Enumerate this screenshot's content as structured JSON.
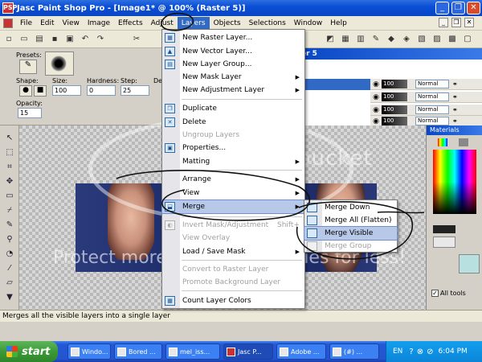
{
  "window": {
    "title": "Jasc Paint Shop Pro - [Image1* @ 100% (Raster 5)]",
    "app_icon": "PSP",
    "controls": [
      "_",
      "❐",
      "✕"
    ]
  },
  "menubar": {
    "items": [
      "File",
      "Edit",
      "View",
      "Image",
      "Effects",
      "Adjust",
      "Layers",
      "Objects",
      "Selections",
      "Window",
      "Help"
    ],
    "active": "Layers"
  },
  "tool_options": {
    "presets_label": "Presets:",
    "shape_label": "Shape:",
    "size_label": "Size:",
    "size_value": "100",
    "hardness_label": "Hardness:",
    "hardness_value": "0",
    "step_label": "Step:",
    "step_value": "25",
    "density_label": "Der",
    "opacity_label": "Opacity:",
    "opacity_value": "15"
  },
  "layer_panel": {
    "title": "er 5",
    "rows": [
      {
        "opacity": "100",
        "mode": "Normal"
      },
      {
        "opacity": "100",
        "mode": "Normal"
      },
      {
        "opacity": "100",
        "mode": "Normal"
      },
      {
        "opacity": "100",
        "mode": "Normal"
      }
    ]
  },
  "materials": {
    "title": "Materials",
    "all_tools_label": "All tools"
  },
  "layers_menu": [
    {
      "label": "New Raster Layer...",
      "icon": "raster-layer-icon",
      "enabled": true
    },
    {
      "label": "New Vector Layer...",
      "icon": "vector-layer-icon",
      "enabled": true
    },
    {
      "label": "New Layer Group...",
      "icon": "layer-group-icon",
      "enabled": true
    },
    {
      "label": "New Mask Layer",
      "icon": "",
      "enabled": true,
      "submenu": true
    },
    {
      "label": "New Adjustment Layer",
      "icon": "",
      "enabled": true,
      "submenu": true
    },
    {
      "label": "Duplicate",
      "icon": "duplicate-icon",
      "enabled": true
    },
    {
      "label": "Delete",
      "icon": "delete-icon",
      "enabled": true
    },
    {
      "label": "Ungroup Layers",
      "icon": "",
      "enabled": false
    },
    {
      "label": "Properties...",
      "icon": "properties-icon",
      "enabled": true
    },
    {
      "label": "Matting",
      "icon": "",
      "enabled": true,
      "submenu": true
    },
    {
      "label": "Arrange",
      "icon": "",
      "enabled": true,
      "submenu": true
    },
    {
      "label": "View",
      "icon": "",
      "enabled": true,
      "submenu": true
    },
    {
      "label": "Merge",
      "icon": "merge-icon",
      "enabled": true,
      "submenu": true,
      "highlighted": true
    },
    {
      "label": "Invert Mask/Adjustment",
      "icon": "invert-icon",
      "enabled": false,
      "shortcut": "Shift+"
    },
    {
      "label": "View Overlay",
      "icon": "",
      "enabled": false
    },
    {
      "label": "Load / Save Mask",
      "icon": "",
      "enabled": true,
      "submenu": true
    },
    {
      "label": "Convert to Raster Layer",
      "icon": "",
      "enabled": false
    },
    {
      "label": "Promote Background Layer",
      "icon": "",
      "enabled": false
    },
    {
      "label": "Count Layer Colors",
      "icon": "count-colors-icon",
      "enabled": true
    }
  ],
  "merge_submenu": [
    {
      "label": "Merge Down",
      "enabled": true
    },
    {
      "label": "Merge All (Flatten)",
      "enabled": true
    },
    {
      "label": "Merge Visible",
      "enabled": true,
      "highlighted": true
    },
    {
      "label": "Merge Group",
      "enabled": false
    }
  ],
  "watermark": {
    "line1": "photobucket",
    "line2": "Protect more of your memories for less!"
  },
  "status": {
    "text": "Merges all the visible layers into a single layer"
  },
  "taskbar": {
    "start_label": "start",
    "tasks": [
      "Windo...",
      "Bored ...",
      "mel_iss...",
      "Jasc P...",
      "Adobe ...",
      "(#) ...",
      "EN"
    ],
    "active_task": "Jasc P...",
    "clock": "6:04 PM"
  },
  "colors": {
    "title_blue": "#0a4fd6",
    "menu_highlight": "#b8c8e8",
    "start_green": "#3b9a36",
    "taskbar_blue": "#2455cf"
  }
}
